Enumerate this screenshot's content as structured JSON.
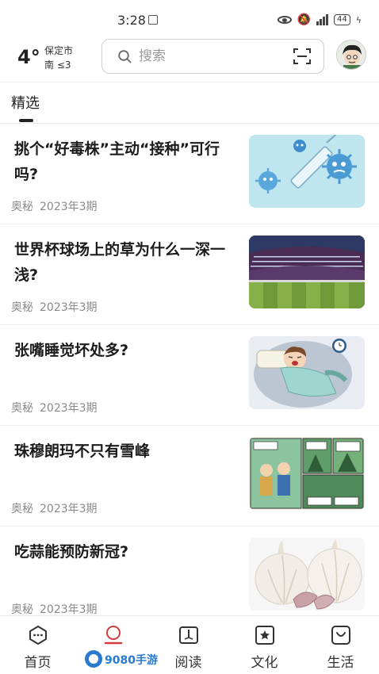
{
  "status_bar": {
    "time": "3:28",
    "battery": "44",
    "network": "4G",
    "icons": [
      "eye-icon",
      "mute-bell-icon",
      "signal-icon",
      "battery-icon",
      "charging-icon"
    ]
  },
  "header": {
    "temperature": "4°",
    "city": "保定市",
    "wind": "南 ≤3",
    "search_placeholder": "搜索",
    "icons": [
      "search-icon",
      "scan-icon",
      "avatar"
    ]
  },
  "tabs": [
    {
      "label": "精选",
      "active": true
    }
  ],
  "articles": [
    {
      "title": "挑个“好毒株”主动“接种”可行吗?",
      "publication": "奥秘",
      "issue": "2023年3期",
      "thumbnail": "virus-syringe-illustration"
    },
    {
      "title": "世界杯球场上的草为什么一深一浅?",
      "publication": "奥秘",
      "issue": "2023年3期",
      "thumbnail": "stadium-photo"
    },
    {
      "title": "张嘴睡觉坏处多?",
      "publication": "奥秘",
      "issue": "2023年3期",
      "thumbnail": "sleeping-child-illustration"
    },
    {
      "title": "珠穆朗玛不只有雪峰",
      "publication": "奥秘",
      "issue": "2023年3期",
      "thumbnail": "comic-strip"
    },
    {
      "title": "吃蒜能预防新冠?",
      "publication": "奥秘",
      "issue": "2023年3期",
      "thumbnail": "garlic-photo"
    }
  ],
  "bottom_nav": [
    {
      "label": "首页",
      "icon": "chat-bubble-icon",
      "active": false
    },
    {
      "label": "",
      "icon": "person-icon",
      "active": true
    },
    {
      "label": "阅读",
      "icon": "book-icon",
      "active": false
    },
    {
      "label": "文化",
      "icon": "star-box-icon",
      "active": false
    },
    {
      "label": "生活",
      "icon": "bag-icon",
      "active": false
    }
  ],
  "watermark": "9080手游网",
  "colors": {
    "accent": "#d23b3b",
    "text_primary": "#1c1c1c",
    "text_meta": "#8a8a8a"
  }
}
